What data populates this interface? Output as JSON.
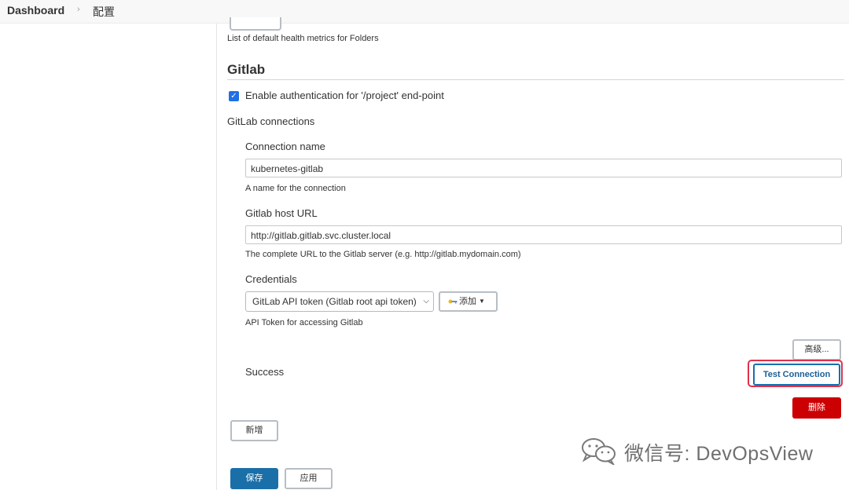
{
  "breadcrumb": {
    "dashboard": "Dashboard",
    "current": "配置",
    "separator": "›"
  },
  "folder_health": {
    "help": "List of default health metrics for Folders"
  },
  "gitlab": {
    "section_title": "Gitlab",
    "enable_auth": {
      "label": "Enable authentication for '/project' end-point",
      "checked": true
    },
    "connections_label": "GitLab connections",
    "connection": {
      "name_label": "Connection name",
      "name_value": "kubernetes-gitlab",
      "name_help": "A name for the connection",
      "host_label": "Gitlab host URL",
      "host_value": "http://gitlab.gitlab.svc.cluster.local",
      "host_help": "The complete URL to the Gitlab server (e.g. http://gitlab.mydomain.com)",
      "credentials_label": "Credentials",
      "credentials_selected": "GitLab API token (Gitlab root api token)",
      "add_label": "添加",
      "credentials_help": "API Token for accessing Gitlab",
      "advanced_label": "高级...",
      "status_text": "Success",
      "test_connection_label": "Test Connection",
      "delete_label": "删除"
    },
    "new_label": "新增"
  },
  "footer": {
    "save_label": "保存",
    "apply_label": "应用"
  },
  "watermark": {
    "text": "微信号: DevOpsView"
  },
  "colors": {
    "primary_button": "#1b6fa8",
    "delete_button": "#cc0003",
    "highlight_border": "#e0314b",
    "checkbox": "#1f6fe5"
  },
  "icons": [
    "chevron-right-icon",
    "checkbox-checked-icon",
    "key-icon",
    "caret-down-icon",
    "wechat-icon"
  ]
}
